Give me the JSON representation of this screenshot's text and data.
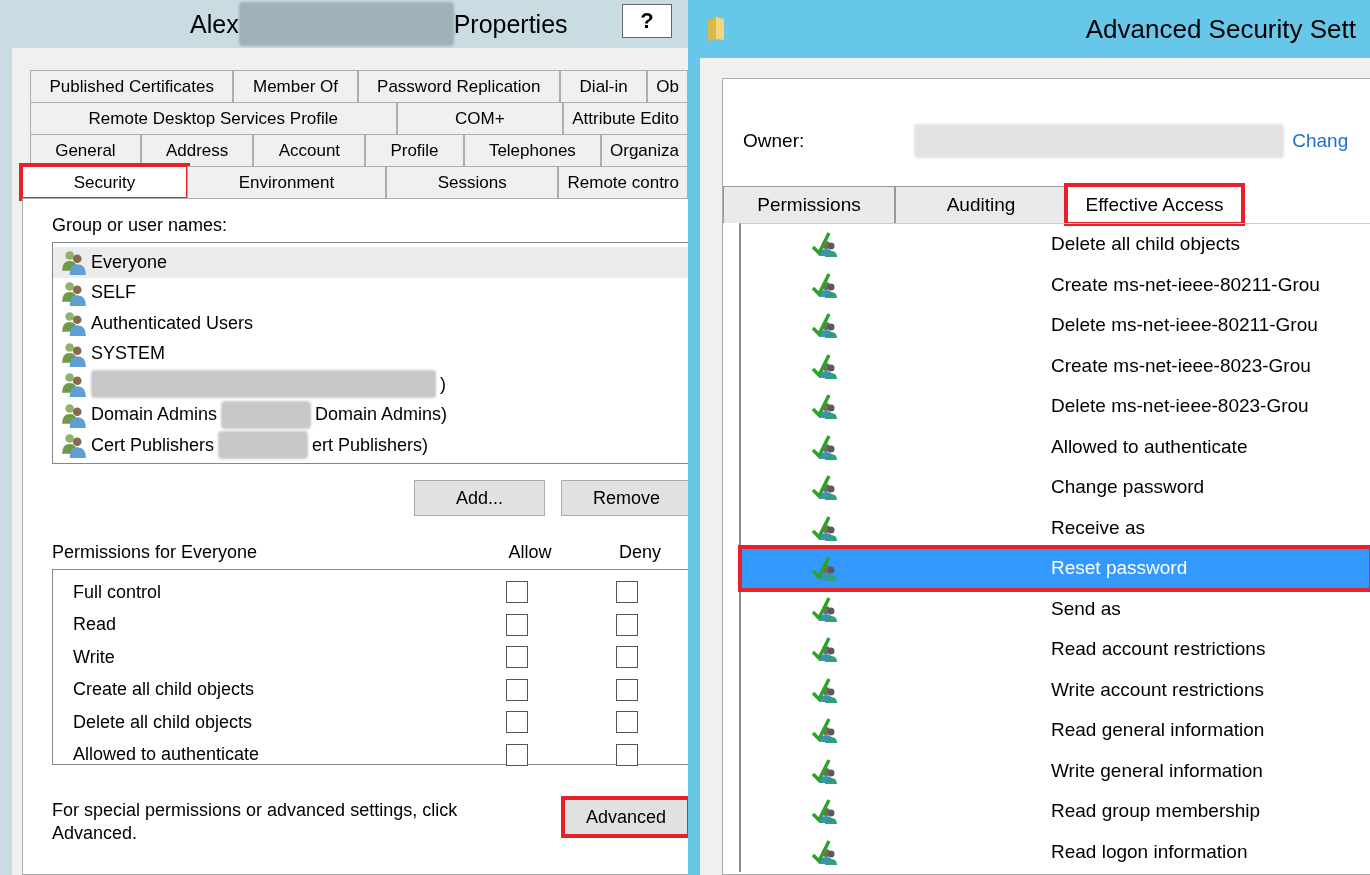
{
  "properties_window": {
    "title_start": "Alex",
    "title_redacted": true,
    "title_end": "Properties",
    "help_button": "?",
    "tab_rows": [
      [
        {
          "label": "Published Certificates",
          "selected": false,
          "highlighted": false
        },
        {
          "label": "Member Of",
          "selected": false,
          "highlighted": false
        },
        {
          "label": "Password Replication",
          "selected": false,
          "highlighted": false
        },
        {
          "label": "Dial-in",
          "selected": false,
          "highlighted": false
        },
        {
          "label": "Ob",
          "selected": false,
          "highlighted": false
        }
      ],
      [
        {
          "label": "Remote Desktop Services Profile",
          "selected": false,
          "highlighted": false
        },
        {
          "label": "COM+",
          "selected": false,
          "highlighted": false
        },
        {
          "label": "Attribute Edito",
          "selected": false,
          "highlighted": false
        }
      ],
      [
        {
          "label": "General",
          "selected": false,
          "highlighted": false
        },
        {
          "label": "Address",
          "selected": false,
          "highlighted": false
        },
        {
          "label": "Account",
          "selected": false,
          "highlighted": false
        },
        {
          "label": "Profile",
          "selected": false,
          "highlighted": false
        },
        {
          "label": "Telephones",
          "selected": false,
          "highlighted": false
        },
        {
          "label": "Organiza",
          "selected": false,
          "highlighted": false
        }
      ],
      [
        {
          "label": "Security",
          "selected": true,
          "highlighted": true
        },
        {
          "label": "Environment",
          "selected": false,
          "highlighted": false
        },
        {
          "label": "Sessions",
          "selected": false,
          "highlighted": false
        },
        {
          "label": "Remote contro",
          "selected": false,
          "highlighted": false
        }
      ]
    ],
    "group_label": "Group or user names:",
    "principals": [
      {
        "name": "Everyone",
        "selected": true,
        "redacted": false
      },
      {
        "name": "SELF",
        "selected": false,
        "redacted": false
      },
      {
        "name": "Authenticated Users",
        "selected": false,
        "redacted": false
      },
      {
        "name": "SYSTEM",
        "selected": false,
        "redacted": false
      },
      {
        "selected": false,
        "redacted": true,
        "suffix": ")"
      },
      {
        "name": "Domain Admins",
        "selected": false,
        "redacted": true,
        "suffix": "Domain Admins)"
      },
      {
        "name": "Cert Publishers",
        "selected": false,
        "redacted": true,
        "suffix": "ert Publishers)"
      }
    ],
    "buttons": [
      "Add...",
      "Remove"
    ],
    "permissions_label": "Permissions for Everyone",
    "allow_label": "Allow",
    "deny_label": "Deny",
    "permissions": [
      {
        "name": "Full control",
        "allow": false,
        "deny": false
      },
      {
        "name": "Read",
        "allow": false,
        "deny": false
      },
      {
        "name": "Write",
        "allow": false,
        "deny": false
      },
      {
        "name": "Create all child objects",
        "allow": false,
        "deny": false
      },
      {
        "name": "Delete all child objects",
        "allow": false,
        "deny": false
      },
      {
        "name": "Allowed to authenticate",
        "allow": false,
        "deny": false
      }
    ],
    "footer_text": "For special permissions or advanced settings, click Advanced.",
    "advanced_button": {
      "label": "Advanced",
      "highlighted": true
    }
  },
  "advanced_window": {
    "title": "Advanced Security Sett",
    "owner_label": "Owner:",
    "owner_redacted": true,
    "change_link": "Chang",
    "tabs": [
      {
        "label": "Permissions",
        "selected": false,
        "highlighted": false
      },
      {
        "label": "Auditing",
        "selected": false,
        "highlighted": false
      },
      {
        "label": "Effective Access",
        "selected": true,
        "highlighted": true
      }
    ],
    "entries": [
      {
        "name": "Delete all child objects",
        "selected": false,
        "highlighted": false
      },
      {
        "name": "Create ms-net-ieee-80211-Grou",
        "selected": false,
        "highlighted": false
      },
      {
        "name": "Delete ms-net-ieee-80211-Grou",
        "selected": false,
        "highlighted": false
      },
      {
        "name": "Create ms-net-ieee-8023-Grou",
        "selected": false,
        "highlighted": false
      },
      {
        "name": "Delete ms-net-ieee-8023-Grou",
        "selected": false,
        "highlighted": false
      },
      {
        "name": "Allowed to authenticate",
        "selected": false,
        "highlighted": false
      },
      {
        "name": "Change password",
        "selected": false,
        "highlighted": false
      },
      {
        "name": "Receive as",
        "selected": false,
        "highlighted": false
      },
      {
        "name": "Reset password",
        "selected": true,
        "highlighted": true
      },
      {
        "name": "Send as",
        "selected": false,
        "highlighted": false
      },
      {
        "name": "Read account restrictions",
        "selected": false,
        "highlighted": false
      },
      {
        "name": "Write account restrictions",
        "selected": false,
        "highlighted": false
      },
      {
        "name": "Read general information",
        "selected": false,
        "highlighted": false
      },
      {
        "name": "Write general information",
        "selected": false,
        "highlighted": false
      },
      {
        "name": "Read group membership",
        "selected": false,
        "highlighted": false
      },
      {
        "name": "Read logon information",
        "selected": false,
        "highlighted": false
      }
    ]
  }
}
